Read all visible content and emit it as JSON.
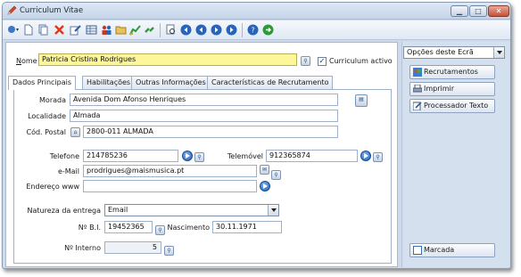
{
  "window": {
    "title": "Curriculum Vitae"
  },
  "toolbar": {
    "icons": [
      "dropdown-icon",
      "new-icon",
      "copy-icon",
      "delete-icon",
      "edit-icon",
      "table-icon",
      "people-icon",
      "folder-icon",
      "chart-icon",
      "link-icon",
      "preview-icon",
      "nav-first-icon",
      "nav-prev-icon",
      "nav-next-icon",
      "nav-last-icon",
      "help-icon",
      "exit-icon"
    ]
  },
  "form": {
    "nome_label": "Nome",
    "nome_value": "Patricia Cristina Rodrigues",
    "curriculum_activo_label": "Curriculum activo",
    "curriculum_activo_checked": true,
    "tabs": [
      "Dados Principais",
      "Habilitações",
      "Outras Informações",
      "Características de Recrutamento"
    ],
    "morada_label": "Morada",
    "morada_value": "Avenida Dom Afonso Henriques",
    "localidade_label": "Localidade",
    "localidade_value": "Almada",
    "cod_postal_label": "Cód. Postal",
    "cod_postal_value": "2800-011 ALMADA",
    "telefone_label": "Telefone",
    "telefone_value": "214785236",
    "telemovel_label": "Telemóvel",
    "telemovel_value": "912365874",
    "email_label": "e-Mail",
    "email_value": "prodrigues@maismusica.pt",
    "endereco_label": "Endereço www",
    "endereco_value": "",
    "natureza_label": "Natureza da entrega",
    "natureza_value": "Email",
    "bi_label": "Nº B.I.",
    "bi_value": "19452365",
    "nascimento_label": "Nascimento",
    "nascimento_value": "30.11.1971",
    "interno_label": "Nº Interno",
    "interno_value": "5"
  },
  "side": {
    "options_select": "Opções deste Ecrã",
    "buttons": [
      "Recrutamentos",
      "Imprimir",
      "Processador Texto"
    ],
    "marcada": "Marcada"
  },
  "colors": {
    "highlight_field": "#fdf79a",
    "panel": "#d5e0ee",
    "title_bar": "#c6d5e8"
  }
}
